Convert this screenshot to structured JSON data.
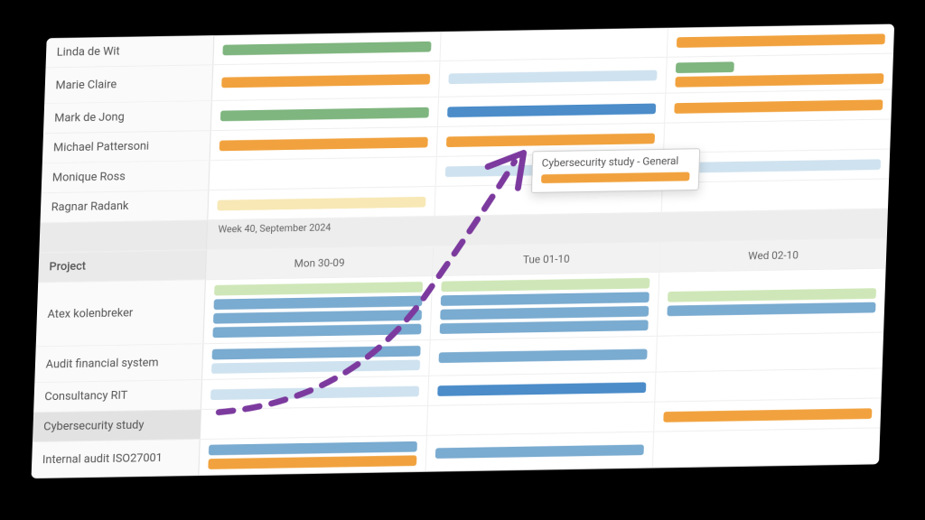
{
  "colors": {
    "green": "#7fb57f",
    "palegreen": "#cfe7b8",
    "orange": "#f1a23e",
    "blue": "#7aabd0",
    "midblue": "#4b8cc9",
    "paleblue": "#cfe2ef",
    "paleyellow": "#f7e8b5",
    "purple": "#7c3a9e"
  },
  "people": {
    "rows": [
      {
        "name": "Linda de Wit",
        "cells": [
          [
            "green"
          ],
          [],
          [
            "orange"
          ]
        ]
      },
      {
        "name": "Marie Claire",
        "cells": [
          [
            "orange"
          ],
          [
            "paleblue"
          ],
          [
            "green_short",
            "orange"
          ]
        ]
      },
      {
        "name": "Mark de Jong",
        "cells": [
          [
            "green"
          ],
          [
            "midblue"
          ],
          [
            "orange"
          ]
        ]
      },
      {
        "name": "Michael Pattersoni",
        "cells": [
          [
            "orange"
          ],
          [
            "orange"
          ],
          []
        ]
      },
      {
        "name": "Monique Ross",
        "cells": [
          [],
          [
            "paleblue"
          ],
          [
            "paleblue"
          ]
        ]
      },
      {
        "name": "Ragnar Radank",
        "cells": [
          [
            "paleyellow"
          ],
          [],
          []
        ]
      }
    ]
  },
  "week_label": "Week 40, September 2024",
  "days": [
    "Mon 30-09",
    "Tue 01-10",
    "Wed 02-10"
  ],
  "projects_header": "Project",
  "projects": {
    "rows": [
      {
        "name": "Atex kolenbreker",
        "selected": false,
        "cells": [
          [
            "palegreen",
            "blue",
            "blue",
            "blue"
          ],
          [
            "palegreen",
            "blue",
            "blue",
            "blue"
          ],
          [
            "palegreen",
            "blue"
          ]
        ]
      },
      {
        "name": "Audit financial system",
        "selected": false,
        "cells": [
          [
            "blue",
            "paleblue"
          ],
          [
            "blue"
          ],
          []
        ]
      },
      {
        "name": "Consultancy RIT",
        "selected": false,
        "cells": [
          [
            "paleblue"
          ],
          [
            "midblue"
          ],
          []
        ]
      },
      {
        "name": "Cybersecurity study",
        "selected": true,
        "cells": [
          [],
          [],
          [
            "orange"
          ]
        ]
      },
      {
        "name": "Internal audit ISO27001",
        "selected": false,
        "cells": [
          [
            "blue",
            "orange"
          ],
          [
            "blue"
          ],
          []
        ]
      }
    ]
  },
  "tooltip": {
    "label": "Cybersecurity study - General",
    "bar_color": "orange"
  }
}
